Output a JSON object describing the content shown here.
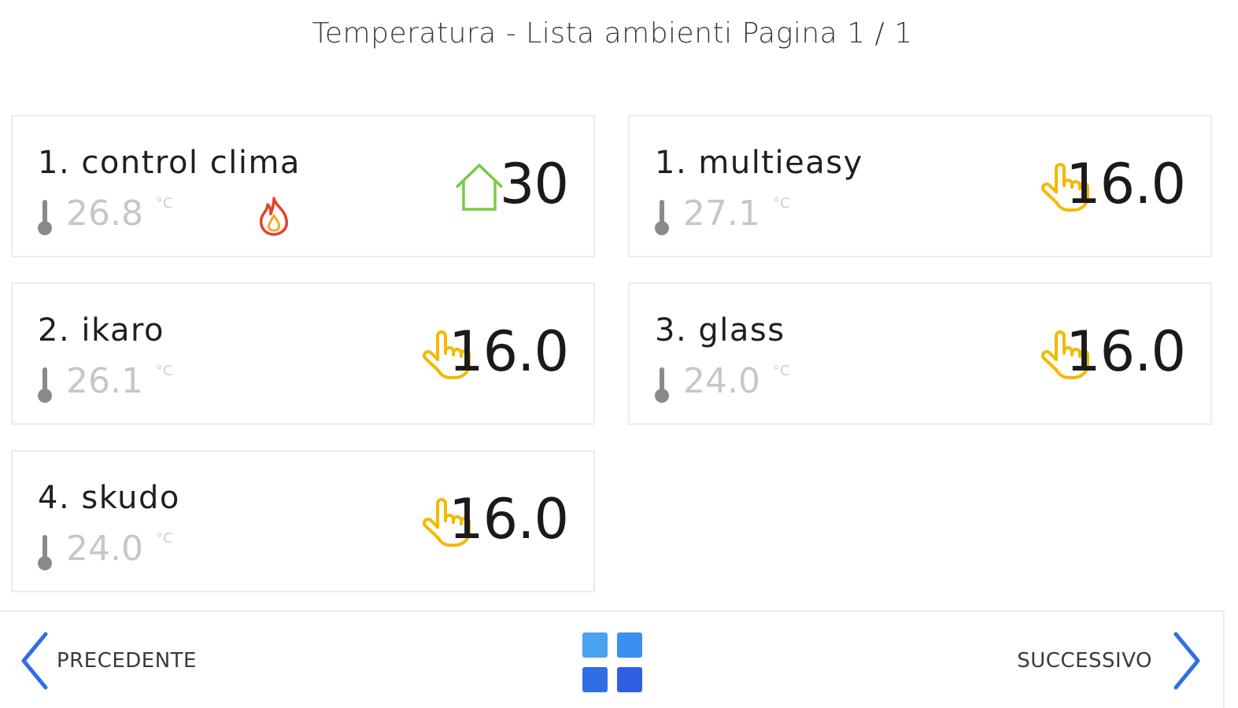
{
  "header": {
    "title": "Temperatura - Lista ambienti Pagina 1 / 1"
  },
  "rooms": [
    {
      "name": "1. control clima",
      "temperature": "26.8",
      "unit": "°C",
      "setpoint": "30",
      "mode_icon": "home-icon",
      "status_icon": "flame-icon"
    },
    {
      "name": "1. multieasy",
      "temperature": "27.1",
      "unit": "°C",
      "setpoint": "16.0",
      "mode_icon": "hand-pointer-icon"
    },
    {
      "name": "2. ikaro",
      "temperature": "26.1",
      "unit": "°C",
      "setpoint": "16.0",
      "mode_icon": "hand-pointer-icon"
    },
    {
      "name": "3. glass",
      "temperature": "24.0",
      "unit": "°C",
      "setpoint": "16.0",
      "mode_icon": "hand-pointer-icon"
    },
    {
      "name": "4. skudo",
      "temperature": "24.0",
      "unit": "°C",
      "setpoint": "16.0",
      "mode_icon": "hand-pointer-icon"
    }
  ],
  "nav": {
    "prev_label": "PRECEDENTE",
    "next_label": "SUCCESSIVO",
    "center_icon": "grid-menu-icon"
  },
  "colors": {
    "home_icon": "#7ac943",
    "hand_icon": "#f5b800",
    "flame_icon": "#e8402a",
    "chevron": "#2f6fe6",
    "grid_light": "#4aa3f0",
    "grid_dark": "#2f5fe0"
  }
}
